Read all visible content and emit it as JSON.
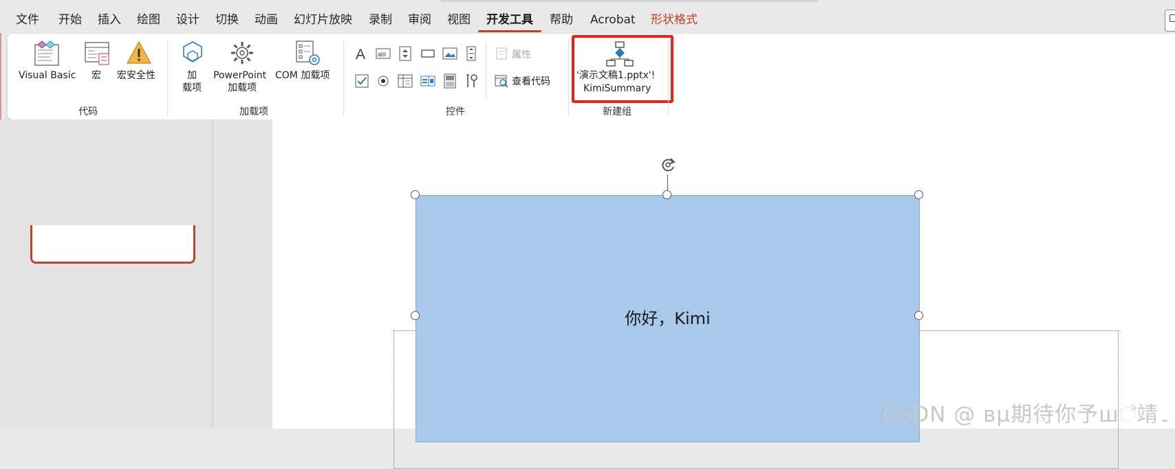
{
  "menu": {
    "tabs": [
      "文件",
      "开始",
      "插入",
      "绘图",
      "设计",
      "切换",
      "动画",
      "幻灯片放映",
      "录制",
      "审阅",
      "视图",
      "开发工具",
      "帮助",
      "Acrobat",
      "形状格式"
    ],
    "active_tab": "开发工具"
  },
  "ribbon": {
    "groups": {
      "code": {
        "label": "代码",
        "visual_basic": "Visual Basic",
        "macros": "宏",
        "macro_security": "宏安全性"
      },
      "addins": {
        "label": "加载项",
        "addins_line1": "加",
        "addins_line2": "载项",
        "ppt_line1": "PowerPoint",
        "ppt_line2": "加载项",
        "com_addins": "COM 加载项"
      },
      "controls": {
        "label": "控件",
        "properties": "属性",
        "view_code": "查看代码"
      },
      "new_group": {
        "label": "新建组",
        "macro_line1": "'演示文稿1.pptx'!",
        "macro_line2": "KimiSummary"
      }
    }
  },
  "slide": {
    "shape_text": "你好，Kimi",
    "shape_fill": "#a8c9ea"
  },
  "watermark": "CSDN @ вμ期待你予ш්靖۔۔",
  "colors": {
    "accent": "#c43e1c",
    "highlight": "#e8221b"
  }
}
